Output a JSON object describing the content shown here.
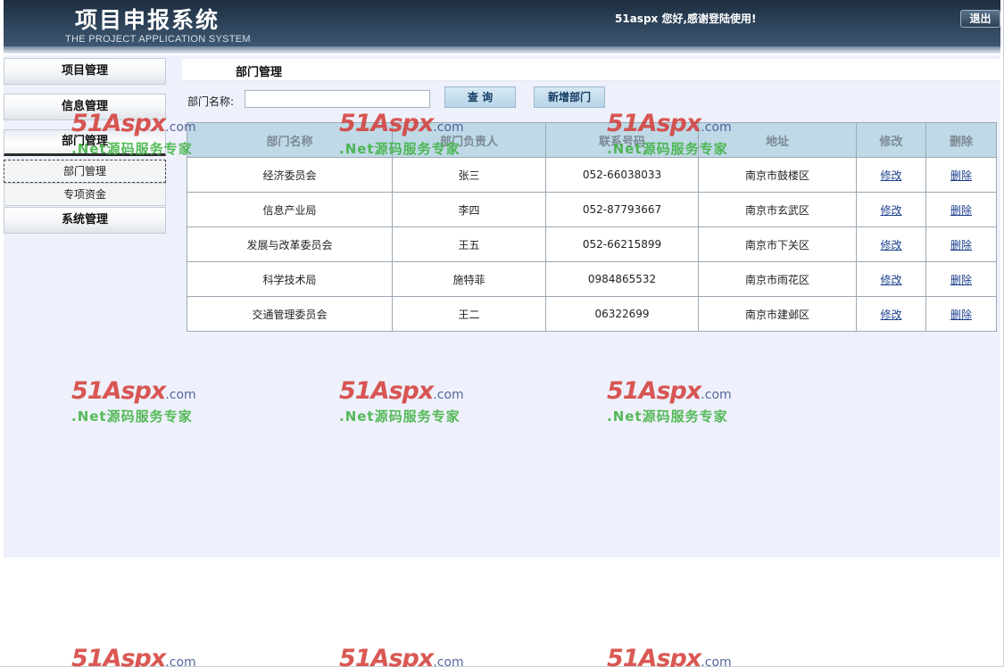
{
  "header": {
    "title_cn": "项目申报系统",
    "title_en": "THE PROJECT APPLICATION SYSTEM",
    "welcome": "51aspx 您好,感谢登陆使用!",
    "logout_label": "退出"
  },
  "sidebar": {
    "menus": [
      {
        "label": "项目管理"
      },
      {
        "label": "信息管理"
      },
      {
        "label": "部门管理"
      },
      {
        "label": "系统管理"
      }
    ],
    "submenu": [
      {
        "label": "部门管理"
      },
      {
        "label": "专项资金"
      }
    ]
  },
  "main": {
    "page_title": "部门管理",
    "search_label": "部门名称:",
    "search_value": "",
    "query_label": "查  询",
    "add_label": "新增部门"
  },
  "table": {
    "headers": [
      "部门名称",
      "部门负责人",
      "联系号码",
      "地址",
      "修改",
      "删除"
    ],
    "rows": [
      {
        "name": "经济委员会",
        "head": "张三",
        "phone": "052-66038033",
        "address": "南京市鼓楼区",
        "edit": "修改",
        "delete": "删除"
      },
      {
        "name": "信息产业局",
        "head": "李四",
        "phone": "052-87793667",
        "address": "南京市玄武区",
        "edit": "修改",
        "delete": "删除"
      },
      {
        "name": "发展与改革委员会",
        "head": "王五",
        "phone": "052-66215899",
        "address": "南京市下关区",
        "edit": "修改",
        "delete": "删除"
      },
      {
        "name": "科学技术局",
        "head": "施特菲",
        "phone": "0984865532",
        "address": "南京市雨花区",
        "edit": "修改",
        "delete": "删除"
      },
      {
        "name": "交通管理委员会",
        "head": "王二",
        "phone": "06322699",
        "address": "南京市建邺区",
        "edit": "修改",
        "delete": "删除"
      }
    ]
  },
  "watermark": {
    "brand": "51Aspx",
    "domain": ".com",
    "slogan": ".Net源码服务专家"
  }
}
